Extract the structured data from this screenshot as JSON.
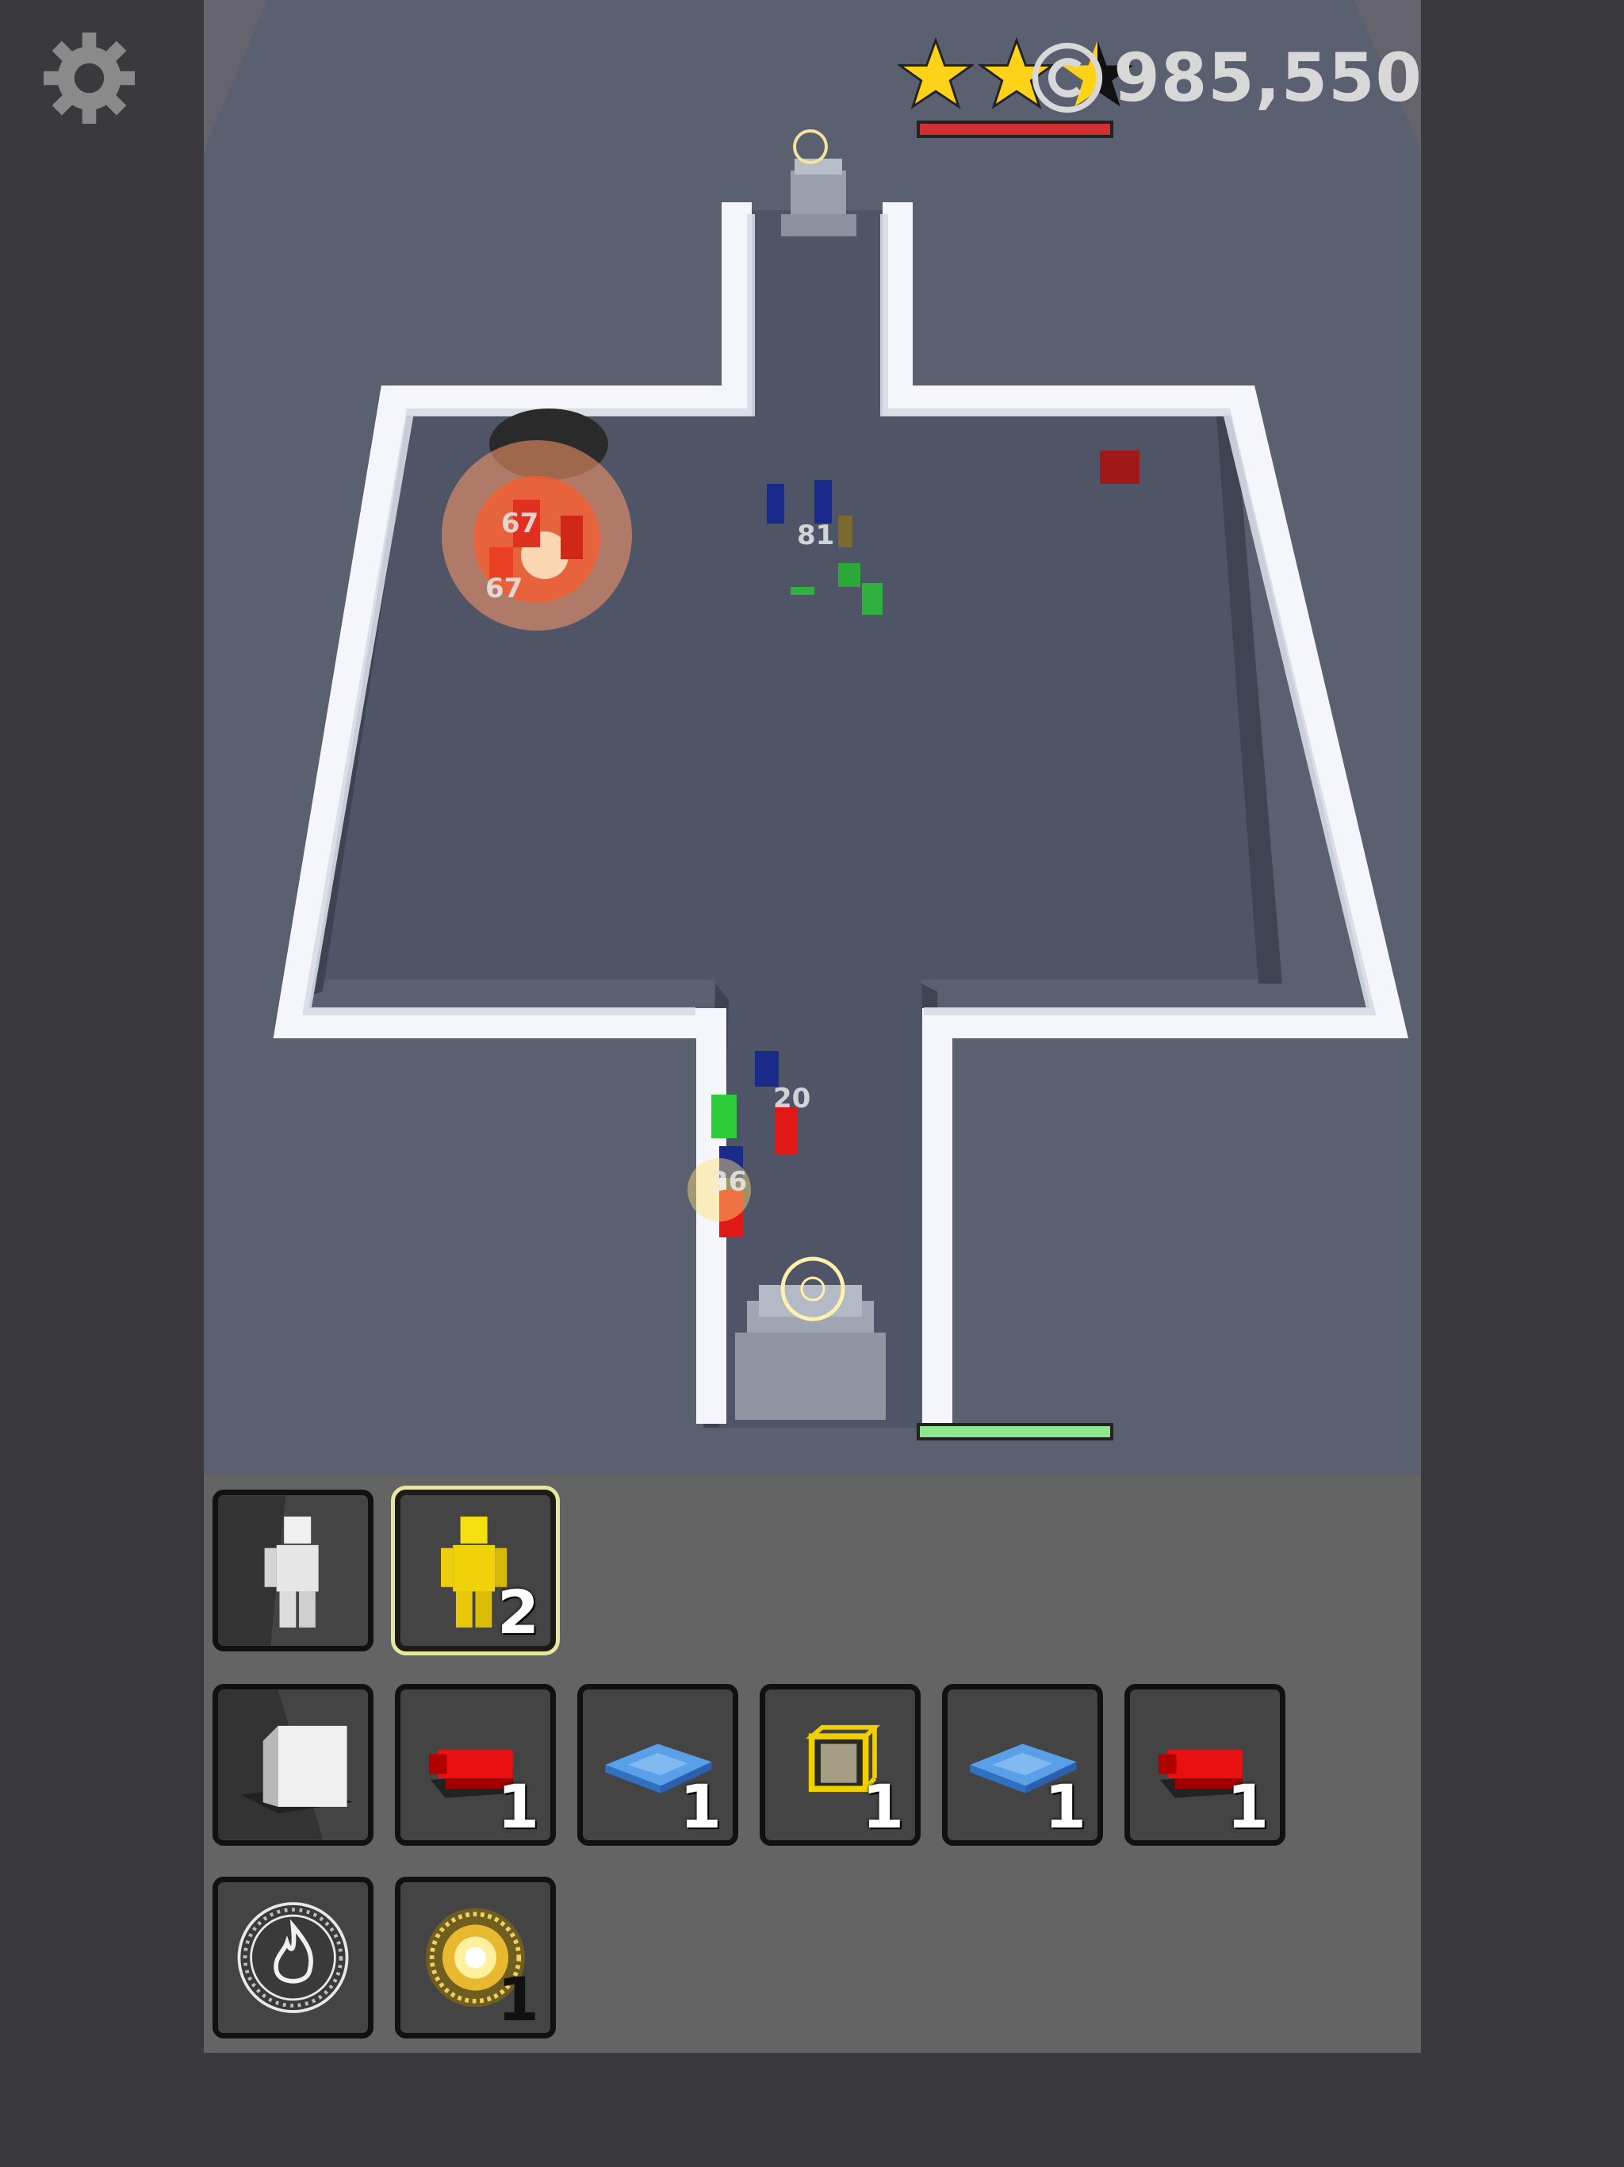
{
  "hud": {
    "settings_icon": "gear-icon",
    "coin_icon": "coin-icon",
    "coins": "985,550",
    "stars_rating": 2.5,
    "stars_max": 3,
    "enemy_base_health": 1.0,
    "player_base_health": 1.0
  },
  "battle": {
    "damage_numbers": [
      "67",
      "67",
      "81",
      "20",
      "36"
    ]
  },
  "inventory": {
    "units": [
      {
        "icon": "white-soldier-icon",
        "count": ""
      },
      {
        "icon": "yellow-soldier-icon",
        "count": "2",
        "selected": true
      }
    ],
    "blocks": [
      {
        "icon": "white-wall-block-icon",
        "count": ""
      },
      {
        "icon": "red-cannon-icon",
        "count": "1"
      },
      {
        "icon": "blue-ice-tile-icon",
        "count": "1"
      },
      {
        "icon": "gold-crate-icon",
        "count": "1"
      },
      {
        "icon": "blue-ice-tile-icon",
        "count": "1"
      },
      {
        "icon": "red-cannon-icon",
        "count": "1"
      }
    ],
    "spells": [
      {
        "icon": "fire-rune-icon",
        "count": ""
      },
      {
        "icon": "light-rune-icon",
        "count": "1"
      }
    ]
  },
  "colors": {
    "background": "#3a3a3e",
    "floor": "#5a6070",
    "wall": "#f2f4fa",
    "inventory_panel": "#646464",
    "star_gold": "#ffd21a",
    "enemy_health": "#d03030",
    "player_health": "#8ee68e"
  }
}
